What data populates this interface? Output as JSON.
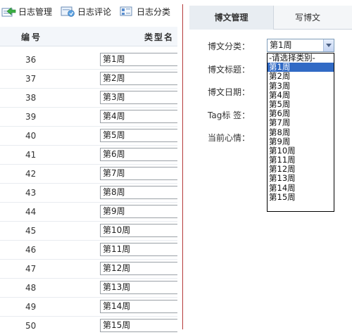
{
  "toolbar": {
    "items": [
      {
        "label": "日志管理",
        "icon": "log-manage-icon"
      },
      {
        "label": "日志评论",
        "icon": "log-comment-icon"
      },
      {
        "label": "日志分类",
        "icon": "log-category-icon"
      }
    ]
  },
  "table": {
    "headers": {
      "number": "编号",
      "type": "类型名"
    },
    "rows": [
      {
        "number": "36",
        "type": "第1周"
      },
      {
        "number": "37",
        "type": "第2周"
      },
      {
        "number": "38",
        "type": "第3周"
      },
      {
        "number": "39",
        "type": "第4周"
      },
      {
        "number": "40",
        "type": "第5周"
      },
      {
        "number": "41",
        "type": "第6周"
      },
      {
        "number": "42",
        "type": "第7周"
      },
      {
        "number": "43",
        "type": "第8周"
      },
      {
        "number": "44",
        "type": "第9周"
      },
      {
        "number": "45",
        "type": "第10周"
      },
      {
        "number": "46",
        "type": "第11周"
      },
      {
        "number": "47",
        "type": "第12周"
      },
      {
        "number": "48",
        "type": "第13周"
      },
      {
        "number": "49",
        "type": "第14周"
      },
      {
        "number": "50",
        "type": "第15周"
      }
    ]
  },
  "tabs": {
    "manage": "博文管理",
    "write": "写博文"
  },
  "form": {
    "category_label": "博文分类：",
    "title_label": "博文标题：",
    "date_label": "博文日期：",
    "tag_label": "Tag标 签：",
    "mood_label": "当前心情：",
    "category_selected": "第1周",
    "category_options": [
      "-请选择类别-",
      "第1周",
      "第2周",
      "第3周",
      "第4周",
      "第5周",
      "第6周",
      "第7周",
      "第8周",
      "第9周",
      "第10周",
      "第11周",
      "第12周",
      "第13周",
      "第14周",
      "第15周"
    ],
    "highlighted_option": "第1周"
  },
  "colors": {
    "divider": "#b53a3a",
    "highlight": "#316ac5"
  }
}
